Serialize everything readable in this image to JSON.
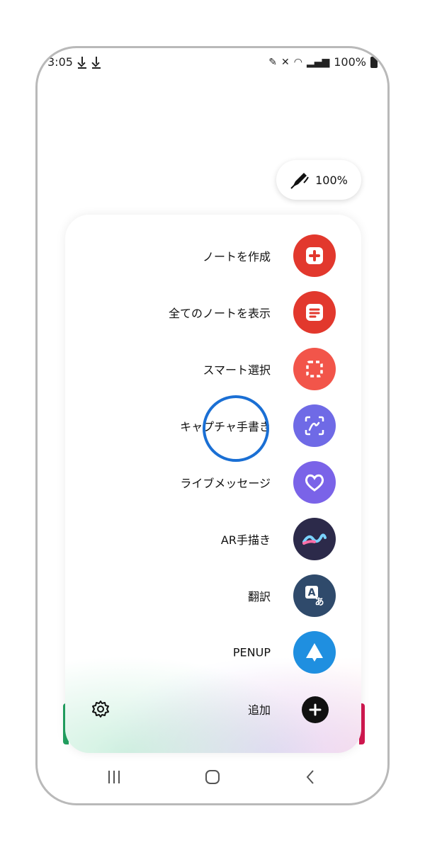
{
  "status": {
    "time": "3:05",
    "battery": "100%"
  },
  "pen_pill": {
    "battery": "100%"
  },
  "menu": {
    "items": [
      {
        "label": "ノートを作成",
        "icon": "note-add-icon",
        "color": "#e2382d"
      },
      {
        "label": "全てのノートを表示",
        "icon": "notes-list-icon",
        "color": "#e2382d"
      },
      {
        "label": "スマート選択",
        "icon": "smart-select-icon",
        "color": "#f2554a"
      },
      {
        "label": "キャプチャ手書き",
        "icon": "screen-write-icon",
        "color": "#6f6ae6"
      },
      {
        "label": "ライブメッセージ",
        "icon": "heart-icon",
        "color": "#7a63e8"
      },
      {
        "label": "AR手描き",
        "icon": "ar-doodle-icon",
        "color": "#2c2a4a"
      },
      {
        "label": "翻訳",
        "icon": "translate-icon",
        "color": "#2f4a6b"
      },
      {
        "label": "PENUP",
        "icon": "penup-icon",
        "color": "#1f8fe0"
      }
    ],
    "add_label": "追加"
  }
}
